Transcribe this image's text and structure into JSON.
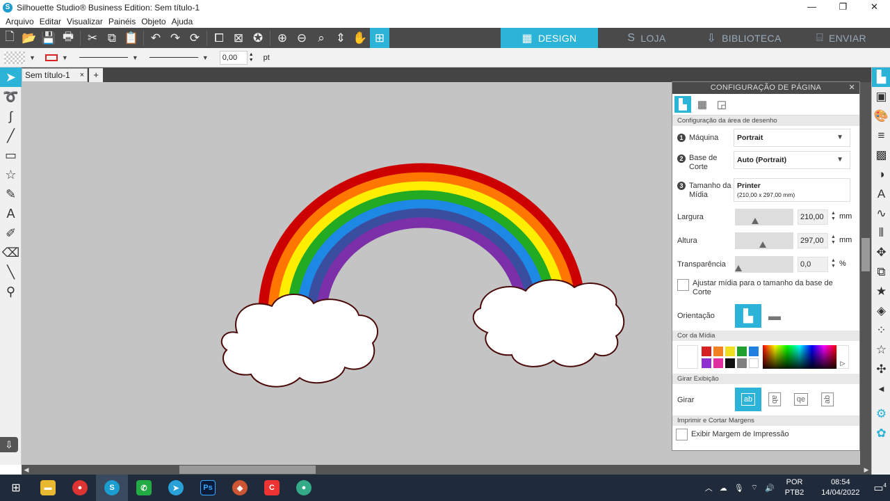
{
  "window": {
    "title": "Silhouette Studio® Business Edition: Sem título-1",
    "minimize": "—",
    "maximize": "❐",
    "close": "✕"
  },
  "menu": [
    "Arquivo",
    "Editar",
    "Visualizar",
    "Painéis",
    "Objeto",
    "Ajuda"
  ],
  "nav_tabs": [
    {
      "label": "DESIGN",
      "icon": "grid-icon",
      "glyph": "▦",
      "active": true
    },
    {
      "label": "LOJA",
      "icon": "silhouette-s-icon",
      "glyph": "S",
      "active": false
    },
    {
      "label": "BIBLIOTECA",
      "icon": "library-icon",
      "glyph": "⇩",
      "active": false
    },
    {
      "label": "ENVIAR",
      "icon": "machine-icon",
      "glyph": "⌸",
      "active": false
    }
  ],
  "options_bar": {
    "line_weight": "0,00",
    "unit": "pt"
  },
  "document_tab": {
    "label": "Sem título-1",
    "close": "×",
    "add": "+"
  },
  "panel": {
    "title": "CONFIGURAÇÃO DE PÁGINA",
    "close": "✕",
    "section_drawing_area": "Configuração da área de desenho",
    "machine": {
      "step": "1",
      "label": "Máquina",
      "value": "Portrait"
    },
    "cutting_mat": {
      "step": "2",
      "label_line1": "Base de",
      "label_line2": "Corte",
      "value": "Auto (Portrait)"
    },
    "media_size": {
      "step": "3",
      "label_line1": "Tamanho da",
      "label_line2": "Mídia",
      "value": "Printer",
      "detail": "(210,00 x 297,00 mm)"
    },
    "width": {
      "label": "Largura",
      "value": "210,00",
      "unit": "mm",
      "slider_level": 0.33
    },
    "height": {
      "label": "Altura",
      "value": "297,00",
      "unit": "mm",
      "slider_level": 0.47
    },
    "transparency": {
      "label": "Transparência",
      "value": "0,0",
      "unit": "%",
      "slider_level": 0.0
    },
    "fit_media_label_line1": "Ajustar mídia para o tamanho da base de",
    "fit_media_label_line2": "Corte",
    "orientation_label": "Orientação",
    "section_media_color": "Cor da Mídia",
    "media_colors": [
      "#d42020",
      "#f08020",
      "#f0e020",
      "#20a030",
      "#2080e0",
      "#9030d0",
      "#e030a0",
      "#101010",
      "#808080",
      "#ffffff"
    ],
    "section_rotate": "Girar Exibição",
    "rotate_label": "Girar",
    "rotate_options": [
      "ab",
      "ab",
      "qe",
      "ab"
    ],
    "section_print_cut": "Imprimir e Cortar Margens",
    "print_margin_label": "Exibir Margem de Impressão"
  },
  "taskbar": {
    "language_line1": "POR",
    "language_line2": "PTB2",
    "time": "08:54",
    "date": "14/04/2022",
    "notifications": "4"
  }
}
